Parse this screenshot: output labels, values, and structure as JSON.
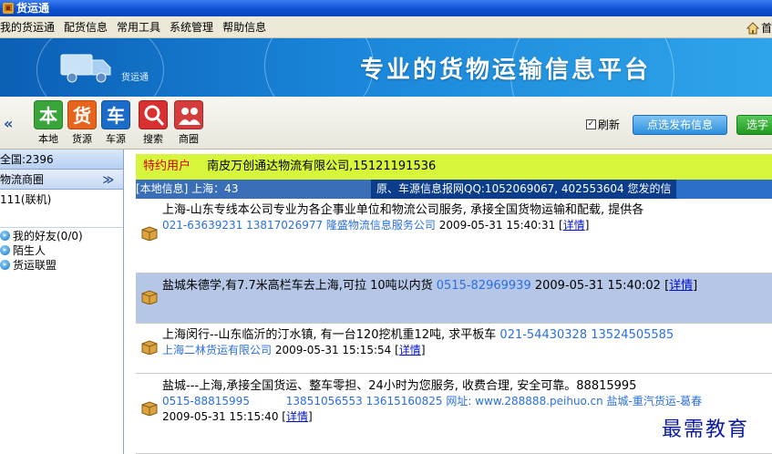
{
  "window": {
    "title": "货运通"
  },
  "menu": {
    "items": [
      "我的货运通",
      "配货信息",
      "常用工具",
      "系统管理",
      "帮助信息"
    ],
    "home_glyph": "首"
  },
  "banner": {
    "logo_text": "货运通",
    "slogan": "专业的货物运输信息平台"
  },
  "toolbar": {
    "collapse": "«",
    "buttons": [
      {
        "glyph": "本",
        "label": "本地",
        "color": "#3aa53a"
      },
      {
        "glyph": "货",
        "label": "货源",
        "color": "#e8641c"
      },
      {
        "glyph": "车",
        "label": "车源",
        "color": "#1b6cc8"
      },
      {
        "glyph": "",
        "label": "搜索",
        "color": "#d83030"
      },
      {
        "glyph": "",
        "label": "商圈",
        "color": "#d63c3c"
      }
    ],
    "refresh_label": "刷新",
    "refresh_checked": true,
    "publish_label": "点选发布信息",
    "green_label": "选字"
  },
  "sidebar": {
    "total": "全国:2396",
    "circle_title": "物流商圈",
    "circle_chevron": "≫",
    "sub_item": "111(联机)",
    "friends": [
      "我的好友(0/0)",
      "陌生人",
      "货运联盟"
    ]
  },
  "special": {
    "tag": "特约用户",
    "text": "南皮万创通达物流有限公司,15121191536"
  },
  "infobar": {
    "local": "[本地信息] 上海：43",
    "notice": "原、车源信息报网QQ:1052069067, 402553604 您发的信"
  },
  "feed": [
    {
      "l1_text": "上海-山东专线本公司专业为各企事业单位和物流公司服务, 承接全国货物运输和配载, 提供各",
      "l2_blue": "021-63639231 13817026977 隆盛物流信息服务公司",
      "l2_date": "2009-05-31 15:40:31",
      "more": "详情"
    },
    {
      "l1_text": "盐城朱德学,有7.7米高栏车去上海,可拉 10吨以内货",
      "l1_blue": "0515-82969939",
      "l1_date": "2009-05-31 15:40:02",
      "more": "详情"
    },
    {
      "l1_text": "上海闵行--山东临沂的汀水镇, 有一台120挖机重12吨, 求平板车",
      "l1_blue": "021-54430328 13524505585",
      "l2_blue": "上海二林货运有限公司",
      "l2_date": "2009-05-31 15:15:54",
      "more": "详情"
    },
    {
      "l1_text": "盐城---上海,承接全国货运、整车零担、24小时为您服务, 收费合理, 安全可靠。88815995",
      "l2_blue": "0515-88815995",
      "l2_blue2": "13851056553 13615160825 网址: www.288888.peihuo.cn 盐城-重汽货运-葛春",
      "l3_date": "2009-05-31 15:15:40",
      "more": "详情"
    }
  ],
  "watermark": "最需教育"
}
